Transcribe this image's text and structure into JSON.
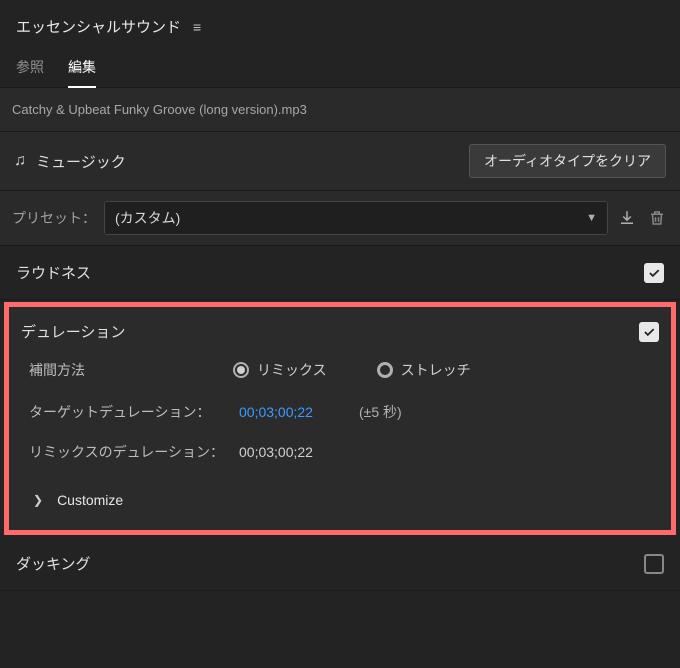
{
  "panel": {
    "title": "エッセンシャルサウンド"
  },
  "tabs": {
    "browse": "参照",
    "edit": "編集"
  },
  "file": {
    "name": "Catchy & Upbeat Funky Groove (long version).mp3"
  },
  "musicRow": {
    "label": "ミュージック",
    "clearButton": "オーディオタイプをクリア"
  },
  "preset": {
    "label": "プリセット：",
    "value": "(カスタム)"
  },
  "sections": {
    "loudness": {
      "title": "ラウドネス",
      "checked": true
    },
    "duration": {
      "title": "デュレーション",
      "checked": true,
      "interpLabel": "補間方法",
      "remixOption": "リミックス",
      "stretchOption": "ストレッチ",
      "targetLabel": "ターゲットデュレーション：",
      "targetValue": "00;03;00;22",
      "tolerance": "(±5 秒)",
      "remixDurLabel": "リミックスのデュレーション：",
      "remixDurValue": "00;03;00;22",
      "customize": "Customize"
    },
    "ducking": {
      "title": "ダッキング",
      "checked": false
    }
  }
}
